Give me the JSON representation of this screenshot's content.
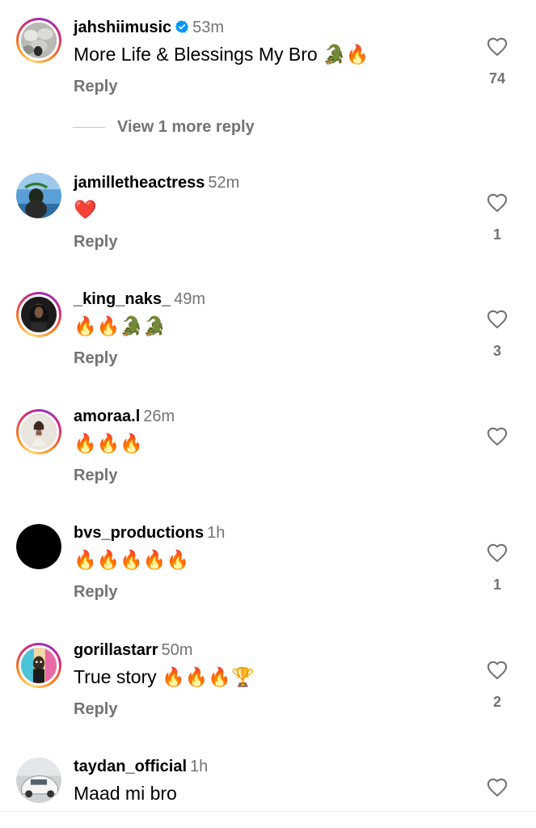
{
  "comments": [
    {
      "username": "jahshiimusic",
      "verified": true,
      "time": "53m",
      "text": "More Life & Blessings My Bro 🐊🔥",
      "reply_label": "Reply",
      "likes": "74",
      "avatar": "sheep-herd-photo"
    },
    {
      "username": "jamilletheactress",
      "verified": false,
      "time": "52m",
      "text": "❤️",
      "reply_label": "Reply",
      "likes": "1",
      "avatar": "beach-photo"
    },
    {
      "username": "_king_naks_",
      "verified": false,
      "time": "49m",
      "text": "🔥🔥🐊🐊",
      "reply_label": "Reply",
      "likes": "3",
      "avatar": "portrait-photo"
    },
    {
      "username": "amoraa.l",
      "verified": false,
      "time": "26m",
      "text": "🔥🔥🔥",
      "reply_label": "Reply",
      "likes": "",
      "avatar": "portrait-photo-light"
    },
    {
      "username": "bvs_productions",
      "verified": false,
      "time": "1h",
      "text": "🔥🔥🔥🔥🔥",
      "reply_label": "Reply",
      "likes": "1",
      "avatar": "black-circle"
    },
    {
      "username": "gorillastarr",
      "verified": false,
      "time": "50m",
      "text": "True story 🔥🔥🔥🏆",
      "reply_label": "Reply",
      "likes": "2",
      "avatar": "cartoon-art"
    },
    {
      "username": "taydan_official",
      "verified": false,
      "time": "1h",
      "text": "Maad mi bro",
      "reply_label": "",
      "likes": "",
      "avatar": "car-photo"
    }
  ],
  "view_more_replies": "View 1 more reply",
  "colors": {
    "muted": "#737373",
    "verified_blue": "#0095f6",
    "story_ring": "#d62976"
  }
}
